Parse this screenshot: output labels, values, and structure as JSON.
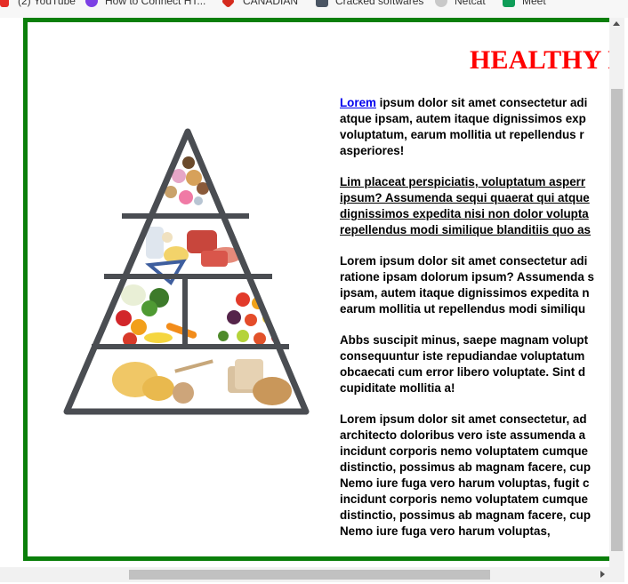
{
  "bookmarks": [
    {
      "label": "(2) YouTube",
      "icon": "youtube-icon"
    },
    {
      "label": "How to Connect HT...",
      "icon": "site-icon"
    },
    {
      "label": "CANADIAN",
      "icon": "maple-leaf-icon"
    },
    {
      "label": "Cracked softwares",
      "icon": "folder-icon"
    },
    {
      "label": "Netcat",
      "icon": "cat-icon"
    },
    {
      "label": "Meet",
      "icon": "meet-icon"
    }
  ],
  "page": {
    "title": "HEALTHY FO",
    "pyramid_alt": "food pyramid image",
    "paragraphs": [
      {
        "link": "Lorem",
        "lines": [
          " ipsum dolor sit amet consectetur adi",
          "atque ipsam, autem itaque dignissimos exp",
          "voluptatum, earum mollitia ut repellendus r",
          "asperiores!"
        ]
      },
      {
        "underlined": true,
        "lines": [
          "Lim placeat perspiciatis, voluptatum asperr",
          "ipsum? Assumenda sequi quaerat qui atque",
          "dignissimos expedita nisi non dolor volupta",
          "repellendus modi similique blanditiis quo as"
        ]
      },
      {
        "lines": [
          "Lorem ipsum dolor sit amet consectetur adi",
          "ratione ipsam dolorum ipsum? Assumenda s",
          "ipsam, autem itaque dignissimos expedita n",
          "earum mollitia ut repellendus modi similiqu"
        ]
      },
      {
        "lines": [
          "Abbs suscipit minus, saepe magnam volupt",
          "consequuntur iste repudiandae voluptatum",
          "obcaecati cum error libero voluptate. Sint d",
          "cupiditate mollitia a!"
        ]
      },
      {
        "lines": [
          "Lorem ipsum dolor sit amet consectetur, ad",
          "architecto doloribus vero iste assumenda a",
          "incidunt corporis nemo voluptatem cumque",
          "distinctio, possimus ab magnam facere, cup",
          "Nemo iure fuga vero harum voluptas, fugit c",
          "incidunt corporis nemo voluptatem cumque",
          "distinctio, possimus ab magnam facere, cup",
          "Nemo iure fuga vero harum voluptas,"
        ]
      }
    ]
  },
  "colors": {
    "border": "#0a7f0a",
    "title": "#ff0000",
    "link": "#0000ee"
  }
}
